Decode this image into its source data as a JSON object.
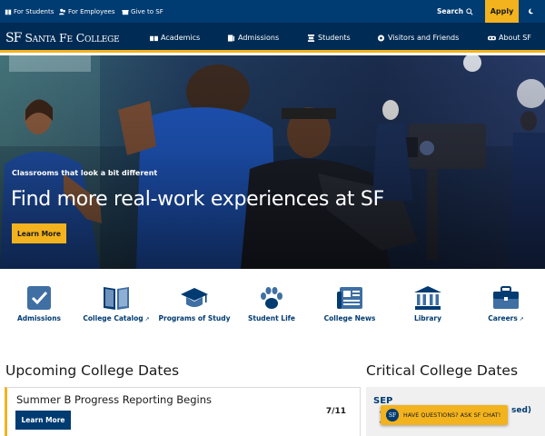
{
  "utility_bar": {
    "links": [
      "For Students",
      "For Employees",
      "Give to SF"
    ],
    "search_label": "Search",
    "apply_label": "Apply"
  },
  "logo": {
    "mark": "SF",
    "name": "Santa Fe College"
  },
  "nav": [
    "Academics",
    "Admissions",
    "Students",
    "Visitors and Friends",
    "About SF"
  ],
  "hero": {
    "eyebrow": "Classrooms that look a bit different",
    "title": "Find more real-work experiences at SF",
    "button": "Learn More"
  },
  "quick_links": [
    {
      "label": "Admissions",
      "icon": "checkbox-icon",
      "external": false
    },
    {
      "label": "College Catalog",
      "icon": "book-icon",
      "external": true
    },
    {
      "label": "Programs of Study",
      "icon": "graduation-cap-icon",
      "external": false
    },
    {
      "label": "Student Life",
      "icon": "paw-icon",
      "external": false
    },
    {
      "label": "College News",
      "icon": "newspaper-icon",
      "external": false
    },
    {
      "label": "Library",
      "icon": "library-icon",
      "external": false
    },
    {
      "label": "Careers",
      "icon": "briefcase-icon",
      "external": true
    }
  ],
  "upcoming": {
    "heading": "Upcoming College Dates",
    "event_title": "Summer B Progress Reporting Begins",
    "event_button": "Learn More",
    "event_date": "7/11"
  },
  "critical": {
    "heading": "Critical College Dates",
    "month": "SEP",
    "partial_text": "sed)"
  },
  "chat": {
    "badge": "SF",
    "label": "HAVE QUESTIONS? ASK SF CHAT!"
  },
  "colors": {
    "navy": "#003b71",
    "dark_navy": "#002b55",
    "gold": "#f2b31e"
  }
}
